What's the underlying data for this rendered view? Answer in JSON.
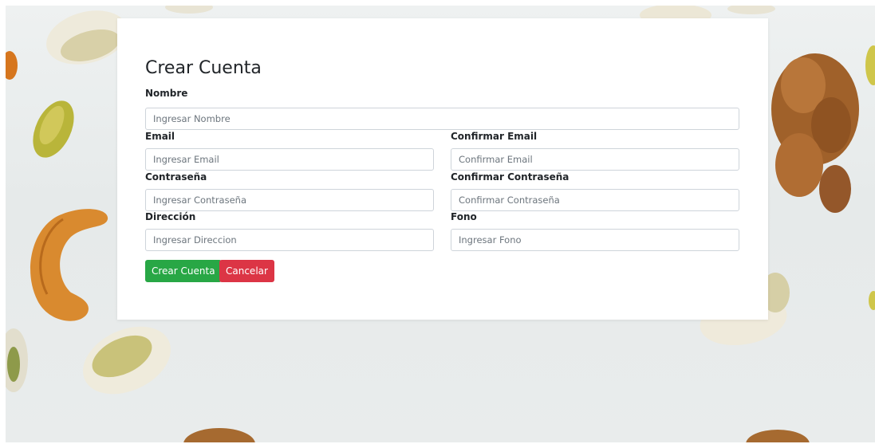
{
  "form": {
    "title": "Crear Cuenta",
    "fields": {
      "nombre": {
        "label": "Nombre",
        "placeholder": "Ingresar Nombre",
        "value": ""
      },
      "email": {
        "label": "Email",
        "placeholder": "Ingresar Email",
        "value": ""
      },
      "confirm_email": {
        "label": "Confirmar Email",
        "placeholder": "Confirmar Email",
        "value": ""
      },
      "password": {
        "label": "Contraseña",
        "placeholder": "Ingresar Contraseña",
        "value": ""
      },
      "confirm_password": {
        "label": "Confirmar Contraseña",
        "placeholder": "Confirmar Contraseña",
        "value": ""
      },
      "direccion": {
        "label": "Dirección",
        "placeholder": "Ingresar Direccion",
        "value": ""
      },
      "fono": {
        "label": "Fono",
        "placeholder": "Ingresar Fono",
        "value": ""
      }
    },
    "buttons": {
      "create": "Crear Cuenta",
      "cancel": "Cancelar"
    }
  },
  "colors": {
    "create_button": "#28a745",
    "cancel_button": "#dc3545",
    "input_border": "#ced4da"
  }
}
